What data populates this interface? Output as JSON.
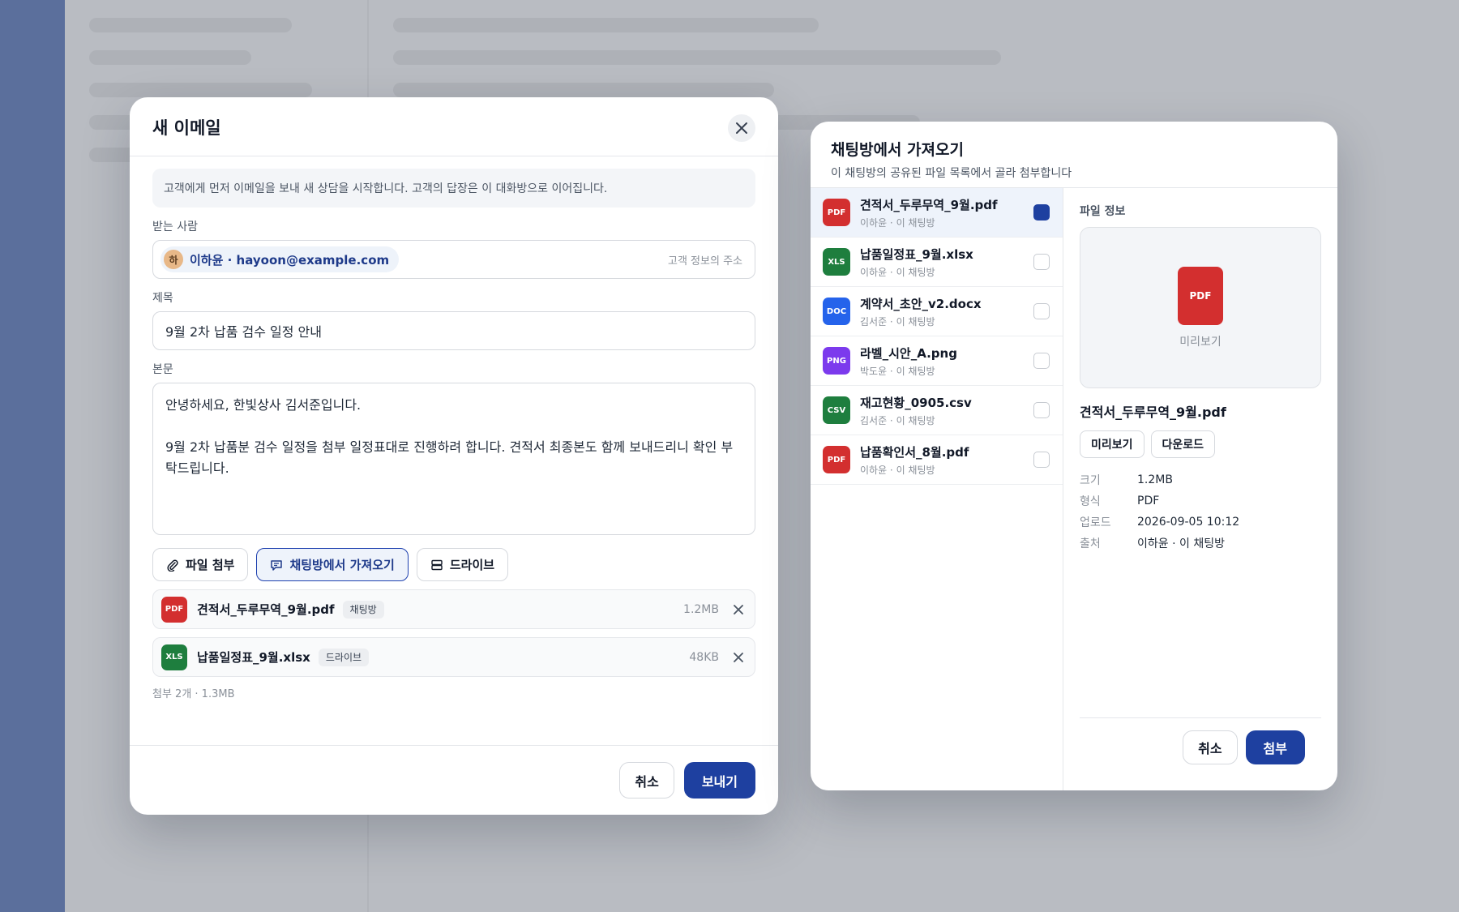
{
  "email": {
    "title": "새 이메일",
    "notice": "고객에게 먼저 이메일을 보내 새 상담을 시작합니다. 고객의 답장은 이 대화방으로 이어집니다.",
    "to_label": "받는 사람",
    "recipient": {
      "avatar": "하",
      "display": "이하윤 · hayoon@example.com",
      "hint": "고객 정보의 주소"
    },
    "subject_label": "제목",
    "subject": "9월 2차 납품 검수 일정 안내",
    "body_label": "본문",
    "body": "안녕하세요, 한빛상사 김서준입니다.\n\n9월 2차 납품분 검수 일정을 첨부 일정표대로 진행하려 합니다. 견적서 최종본도 함께 보내드리니 확인 부탁드립니다.",
    "tools": {
      "attach": "파일 첨부",
      "chat_import": "채팅방에서 가져오기",
      "drive": "드라이브"
    },
    "attachments": [
      {
        "type": "PDF",
        "name": "견적서_두루무역_9월.pdf",
        "tag": "채팅방",
        "size": "1.2MB"
      },
      {
        "type": "XLS",
        "name": "납품일정표_9월.xlsx",
        "tag": "드라이브",
        "size": "48KB"
      }
    ],
    "summary": "첨부 2개 · 1.3MB",
    "cancel": "취소",
    "send": "보내기"
  },
  "chat_import": {
    "title": "채팅방에서 가져오기",
    "subtitle": "이 채팅방의 공유된 파일 목록에서 골라 첨부합니다",
    "files": [
      {
        "type": "PDF",
        "name": "견적서_두루무역_9월.pdf",
        "meta": "이하윤 · 이 채팅방",
        "checked": true
      },
      {
        "type": "XLS",
        "name": "납품일정표_9월.xlsx",
        "meta": "이하윤 · 이 채팅방",
        "checked": false
      },
      {
        "type": "DOC",
        "name": "계약서_초안_v2.docx",
        "meta": "김서준 · 이 채팅방",
        "checked": false
      },
      {
        "type": "PNG",
        "name": "라벨_시안_A.png",
        "meta": "박도윤 · 이 채팅방",
        "checked": false
      },
      {
        "type": "CSV",
        "name": "재고현황_0905.csv",
        "meta": "김서준 · 이 채팅방",
        "checked": false
      },
      {
        "type": "PDF",
        "name": "납품확인서_8월.pdf",
        "meta": "이하윤 · 이 채팅방",
        "checked": false
      }
    ],
    "detail": {
      "label": "파일 정보",
      "preview_type": "PDF",
      "preview_text": "미리보기",
      "name": "견적서_두루무역_9월.pdf",
      "preview_button": "미리보기",
      "download_button": "다운로드",
      "meta": [
        {
          "key": "크기",
          "value": "1.2MB"
        },
        {
          "key": "형식",
          "value": "PDF"
        },
        {
          "key": "업로드",
          "value": "2026-09-05 10:12"
        },
        {
          "key": "출처",
          "value": "이하윤 · 이 채팅방"
        }
      ]
    },
    "cancel": "취소",
    "attach": "첨부"
  },
  "colors": {
    "primary": "#1e40a0",
    "pdf": "#d32f2f",
    "xls": "#1e7e3e",
    "doc": "#2563eb",
    "png": "#7c3aed",
    "csv": "#1e7e3e"
  }
}
